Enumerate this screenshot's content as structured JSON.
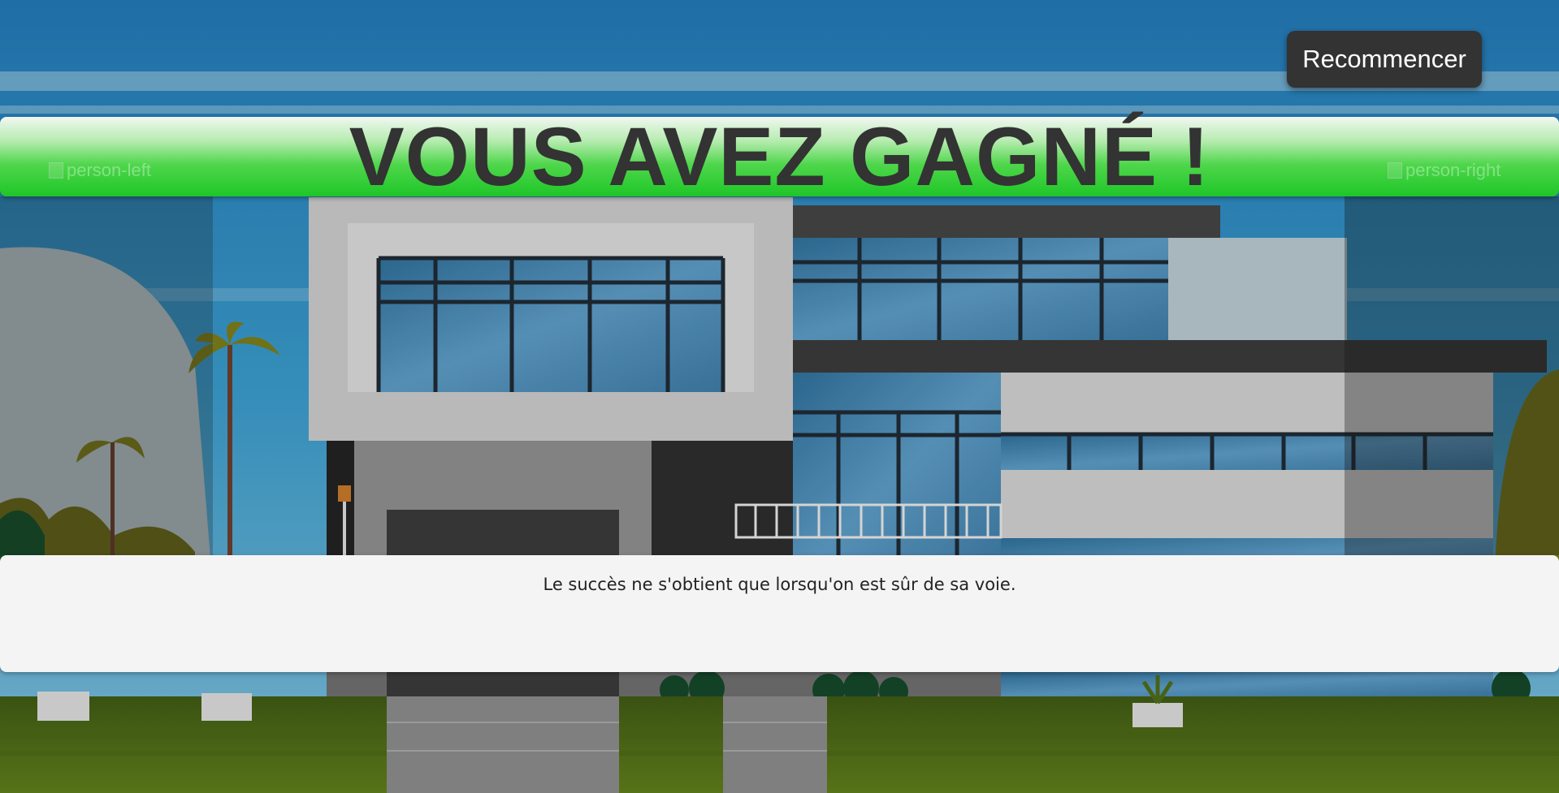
{
  "game": {
    "restart_label": "Recommencer",
    "win_title": "VOUS AVEZ GAGNÉ !",
    "message": "Le succès ne s'obtient que lorsqu'on est sûr de sa voie.",
    "person_left_alt": "person-left",
    "person_right_alt": "person-right"
  },
  "colors": {
    "sky": "#2f8fc2",
    "banner_green": "#1ec628",
    "button_bg": "#333333",
    "title_text": "#333333",
    "panel_bg": "#f4f4f4",
    "lawn": "#4e6b1a"
  }
}
